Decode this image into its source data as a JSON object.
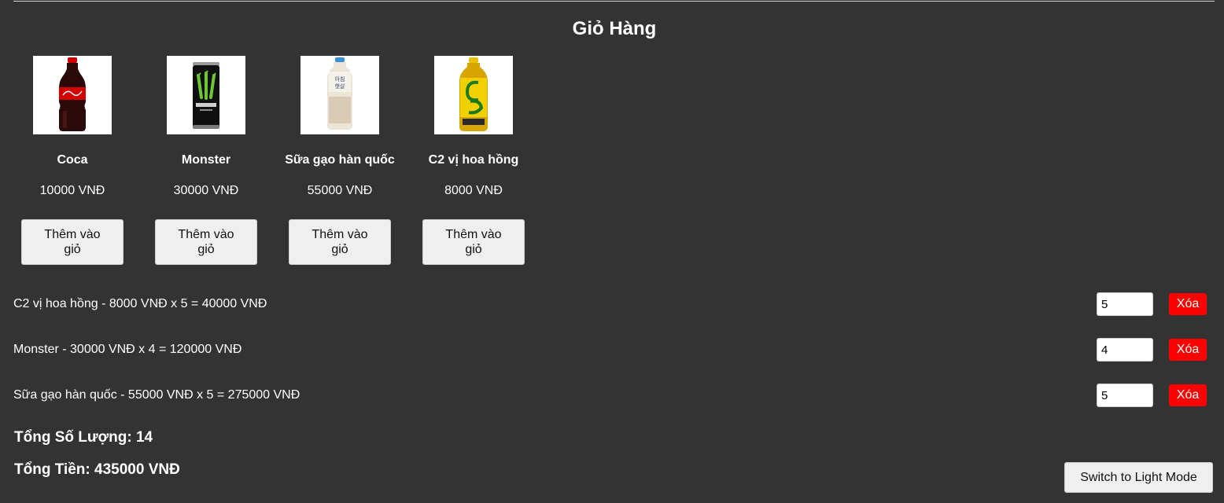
{
  "header": {
    "title": "Giỏ Hàng"
  },
  "products": [
    {
      "name": "Coca",
      "price": "10000 VNĐ",
      "button": "Thêm vào giỏ",
      "image_icon": "cola-bottle-icon"
    },
    {
      "name": "Monster",
      "price": "30000 VNĐ",
      "button": "Thêm vào giỏ",
      "image_icon": "energy-can-icon"
    },
    {
      "name": "Sữa gạo hàn quốc",
      "price": "55000 VNĐ",
      "button": "Thêm vào giỏ",
      "image_icon": "rice-milk-bottle-icon"
    },
    {
      "name": "C2 vị hoa hồng",
      "price": "8000 VNĐ",
      "button": "Thêm vào giỏ",
      "image_icon": "tea-bottle-icon"
    }
  ],
  "cart": {
    "items": [
      {
        "text": "C2 vị hoa hồng - 8000 VNĐ x 5 = 40000 VNĐ",
        "quantity": "5",
        "remove": "Xóa"
      },
      {
        "text": "Monster - 30000 VNĐ x 4 = 120000 VNĐ",
        "quantity": "4",
        "remove": "Xóa"
      },
      {
        "text": "Sữa gạo hàn quốc - 55000 VNĐ x 5 = 275000 VNĐ",
        "quantity": "5",
        "remove": "Xóa"
      }
    ],
    "total_quantity": "Tổng Số Lượng: 14",
    "total_price": "Tổng Tiền: 435000 VNĐ"
  },
  "theme_toggle": {
    "label": "Switch to Light Mode"
  },
  "colors": {
    "background": "#333333",
    "text": "#ffffff",
    "remove_button": "#ff0000",
    "button_bg": "#efefef"
  }
}
